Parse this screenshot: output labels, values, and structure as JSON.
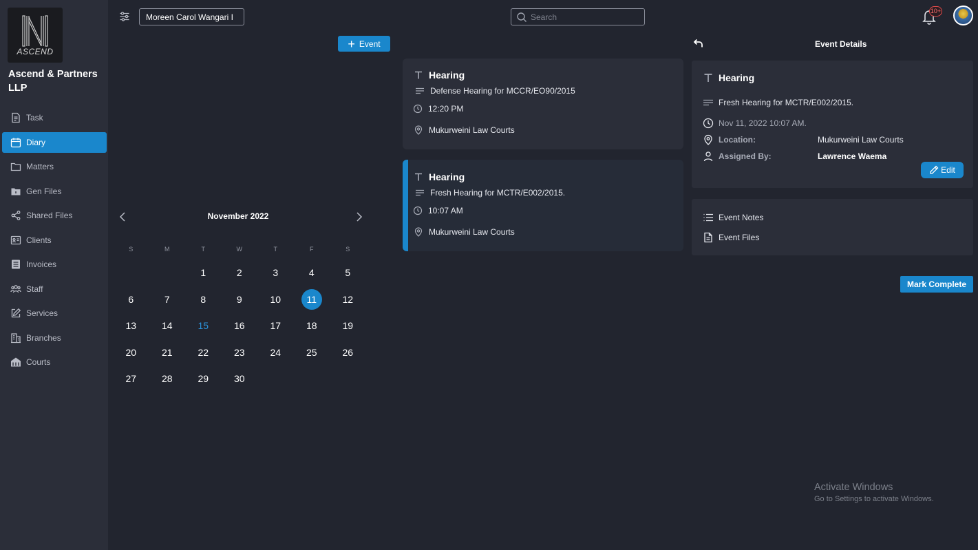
{
  "firm": {
    "logo_text": "ASCEND",
    "name": "Ascend & Partners LLP"
  },
  "sidebar": {
    "items": [
      {
        "label": "Task",
        "icon": "task-icon"
      },
      {
        "label": "Diary",
        "icon": "calendar-icon",
        "active": true
      },
      {
        "label": "Matters",
        "icon": "folder-icon"
      },
      {
        "label": "Gen Files",
        "icon": "folder-filled-icon"
      },
      {
        "label": "Shared Files",
        "icon": "share-icon"
      },
      {
        "label": "Clients",
        "icon": "id-card-icon"
      },
      {
        "label": "Invoices",
        "icon": "invoice-icon"
      },
      {
        "label": "Staff",
        "icon": "people-icon"
      },
      {
        "label": "Services",
        "icon": "edit-square-icon"
      },
      {
        "label": "Branches",
        "icon": "building-icon"
      },
      {
        "label": "Courts",
        "icon": "court-icon"
      }
    ]
  },
  "topbar": {
    "user_value": "Moreen Carol Wangari I",
    "search_placeholder": "Search",
    "notification_badge": "10+"
  },
  "diary": {
    "add_event_label": "Event"
  },
  "calendar": {
    "title": "November 2022",
    "weekdays": [
      "S",
      "M",
      "T",
      "W",
      "T",
      "F",
      "S"
    ],
    "leading_blanks": 2,
    "days_in_month": 30,
    "selected_day": 11,
    "today": 15
  },
  "events": [
    {
      "title": "Hearing",
      "description": "Defense Hearing for MCCR/EO90/2015",
      "time": "12:20 PM",
      "location": "Mukurweini Law Courts"
    },
    {
      "title": "Hearing",
      "description": "Fresh Hearing for MCTR/E002/2015.",
      "time": "10:07 AM",
      "location": "Mukurweini Law Courts"
    }
  ],
  "details": {
    "header": "Event Details",
    "title": "Hearing",
    "description": "Fresh Hearing for MCTR/E002/2015.",
    "datetime": "Nov 11, 2022 10:07 AM.",
    "location_label": "Location:",
    "location_value": "Mukurweini Law Courts",
    "assigned_label": "Assigned By:",
    "assigned_value": "Lawrence Waema",
    "edit_label": "Edit",
    "notes_label": "Event Notes",
    "files_label": "Event Files",
    "mark_complete_label": "Mark Complete"
  },
  "watermark": {
    "line1": "Activate Windows",
    "line2": "Go to Settings to activate Windows."
  },
  "colors": {
    "accent": "#1a87cc",
    "background": "#22252f",
    "panel": "#2b2e39",
    "badge": "#e24b4b"
  }
}
